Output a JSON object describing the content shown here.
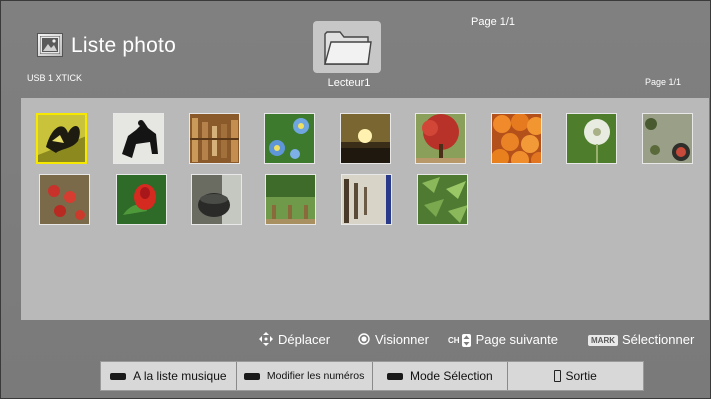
{
  "header": {
    "title": "Liste photo",
    "device": "USB 1 XTICK",
    "folder_label": "Lecteur1",
    "page_indicator_top": "Page 1/1",
    "page_indicator_right": "Page 1/1"
  },
  "thumbnails": [
    {
      "name": "butterfly",
      "selected": true
    },
    {
      "name": "horse-rider"
    },
    {
      "name": "library-shelves"
    },
    {
      "name": "blue-flowers"
    },
    {
      "name": "sunset"
    },
    {
      "name": "red-tree"
    },
    {
      "name": "oranges"
    },
    {
      "name": "dandelion"
    },
    {
      "name": "garden-pots"
    },
    {
      "name": "rose-hips"
    },
    {
      "name": "red-rose"
    },
    {
      "name": "stone-basin"
    },
    {
      "name": "park-benches"
    },
    {
      "name": "corridor"
    },
    {
      "name": "bamboo"
    }
  ],
  "hints": {
    "move": "Déplacer",
    "view": "Visionner",
    "ch_label": "CH",
    "next_page": "Page suivante",
    "mark_label": "MARK",
    "select": "Sélectionner"
  },
  "buttons": {
    "music_list": "A la liste musique",
    "edit_numbers": "Modifier les numéros",
    "selection_mode": "Mode Sélection",
    "exit": "Sortie"
  },
  "colors": {
    "background": "#7c7c7c",
    "grid_panel": "#b9b9b9",
    "selection_border": "#f6e800",
    "button_bar": "#d8d8d8"
  }
}
